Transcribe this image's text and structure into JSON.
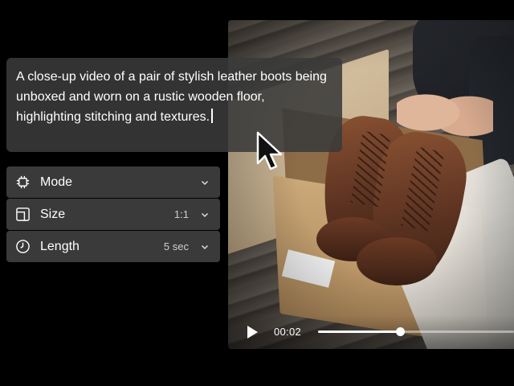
{
  "prompt": {
    "text": "A close-up video of a pair of stylish leather boots being unboxed and worn on a rustic wooden floor, highlighting stitching and textures."
  },
  "settings": {
    "rows": [
      {
        "label": "Mode",
        "value": "",
        "icon": "chip-icon"
      },
      {
        "label": "Size",
        "value": "1:1",
        "icon": "aspect-ratio-icon"
      },
      {
        "label": "Length",
        "value": "5 sec",
        "icon": "clock-icon"
      }
    ]
  },
  "player": {
    "time": "00:02",
    "progress": 0.42,
    "play_icon": "play-icon"
  },
  "colors": {
    "panel": "#3a3a3a",
    "overlay": "#3a3a3a",
    "text": "#ffffff",
    "background": "#000000"
  }
}
